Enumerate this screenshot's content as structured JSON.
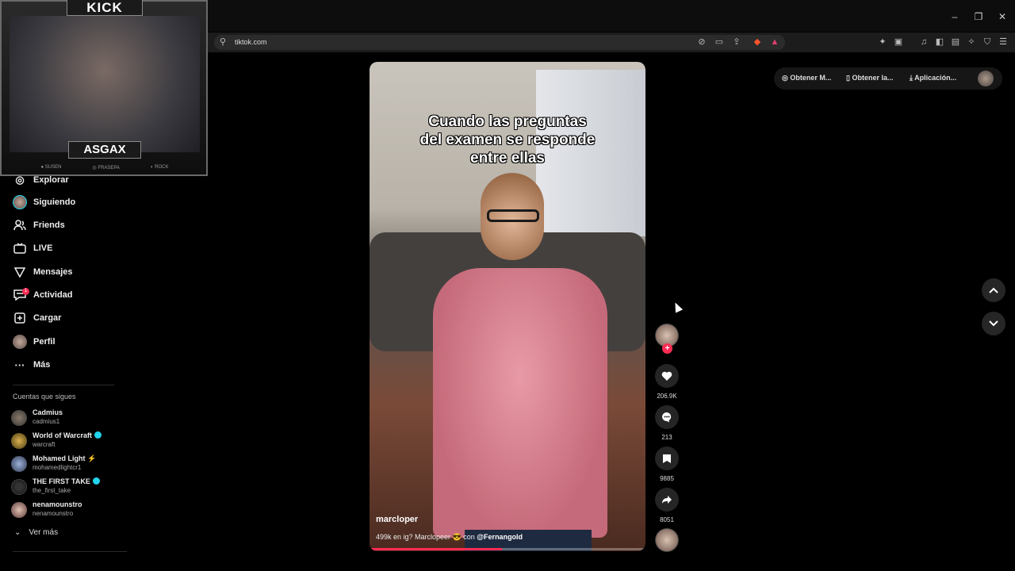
{
  "browser": {
    "url": "tiktok.com",
    "window_controls": {
      "minimize": "–",
      "restore": "❐",
      "close": "✕"
    }
  },
  "stream_overlay": {
    "brand": "KICK",
    "streamer": "ASGAX",
    "footer": [
      "● SUSEN",
      "◎ FRASEPA",
      "◐ ROCK"
    ]
  },
  "sidebar": {
    "nav": [
      {
        "label": "Explorar",
        "icon": "compass-icon",
        "glyph": "◎"
      },
      {
        "label": "Siguiendo",
        "icon": "avatar-icon",
        "glyph": ""
      },
      {
        "label": "Friends",
        "icon": "friends-icon",
        "glyph": "👥"
      },
      {
        "label": "LIVE",
        "icon": "live-icon",
        "glyph": "▣"
      },
      {
        "label": "Mensajes",
        "icon": "messages-icon",
        "glyph": "▽"
      },
      {
        "label": "Actividad",
        "icon": "activity-icon",
        "glyph": "▭"
      },
      {
        "label": "Cargar",
        "icon": "upload-icon",
        "glyph": "⊞"
      },
      {
        "label": "Perfil",
        "icon": "profile-avatar-icon",
        "glyph": ""
      },
      {
        "label": "Más",
        "icon": "more-icon",
        "glyph": "···"
      }
    ],
    "activity_badge": "1",
    "following_title": "Cuentas que sigues",
    "following": [
      {
        "name": "Cadmius",
        "username": "cadmius1",
        "verified": false,
        "suffix": ""
      },
      {
        "name": "World of Warcraft",
        "username": "warcraft",
        "verified": true,
        "suffix": ""
      },
      {
        "name": "Mohamed Light",
        "username": "mohamedlightcr1",
        "verified": false,
        "suffix": "⚡"
      },
      {
        "name": "THE FIRST TAKE",
        "username": "the_first_take",
        "verified": true,
        "suffix": ""
      },
      {
        "name": "nenamounstro",
        "username": "nenamounstro",
        "verified": false,
        "suffix": ""
      }
    ],
    "see_more": "Ver más"
  },
  "top_actions": {
    "btn1": "Obtener M...",
    "btn2": "Obtener la...",
    "btn3": "Aplicación..."
  },
  "video": {
    "caption_lines": [
      "Cuando las preguntas",
      "del examen se responde",
      "entre ellas"
    ],
    "username": "marcloper",
    "description": "499k en ig? Marclopeer 😎  con ",
    "mention": "@Fernangold",
    "progress": 0.48
  },
  "rail": {
    "likes": "206.9K",
    "comments": "213",
    "saves": "9885",
    "shares": "8051"
  },
  "colors": {
    "accent": "#fe2c55",
    "verified": "#20d5ec",
    "background": "#000000"
  }
}
